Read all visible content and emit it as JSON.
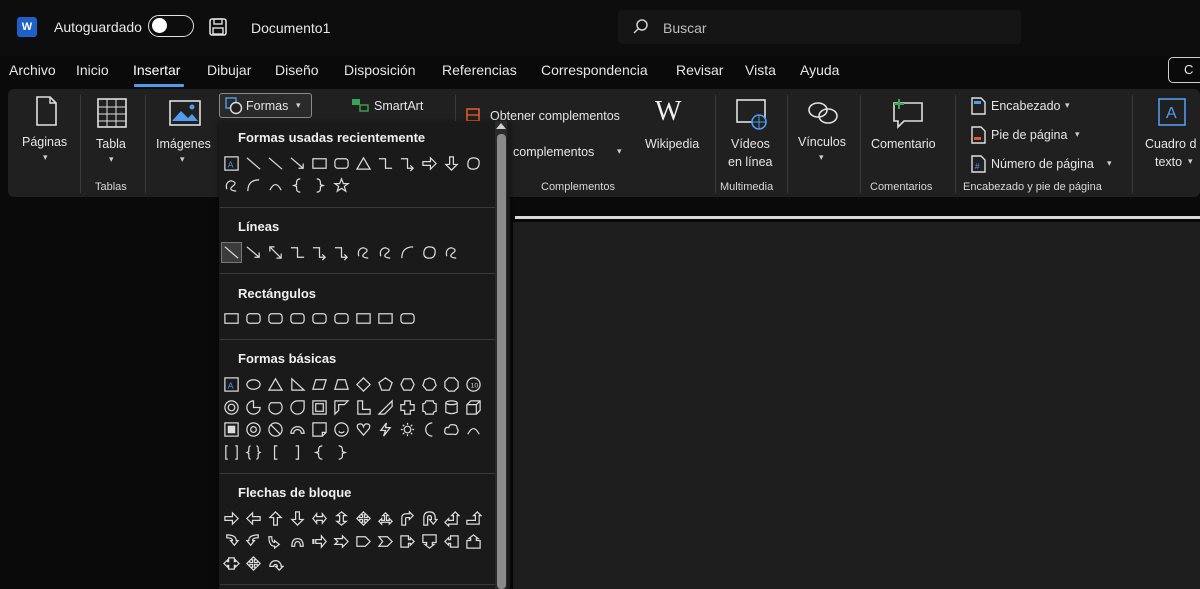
{
  "titlebar": {
    "app_icon": "W",
    "autosave_label": "Autoguardado",
    "document_name": "Documento1",
    "search_placeholder": "Buscar",
    "right_edge_button": "C"
  },
  "tabs": [
    "Archivo",
    "Inicio",
    "Insertar",
    "Dibujar",
    "Diseño",
    "Disposición",
    "Referencias",
    "Correspondencia",
    "Revisar",
    "Vista",
    "Ayuda"
  ],
  "active_tab": "Insertar",
  "ribbon": {
    "pages": "Páginas",
    "table": "Tabla",
    "tables_group": "Tablas",
    "images": "Imágenes",
    "shapes": "Formas",
    "smartart": "SmartArt",
    "get_addins": "Obtener complementos",
    "my_addins": "complementos",
    "addins_group": "Complementos",
    "wikipedia": "Wikipedia",
    "online_video_1": "Vídeos",
    "online_video_2": "en línea",
    "multimedia_group": "Multimedia",
    "links": "Vínculos",
    "comment": "Comentario",
    "comments_group": "Comentarios",
    "header": "Encabezado",
    "footer": "Pie de página",
    "page_number": "Número de página",
    "header_footer_group": "Encabezado y pie de página",
    "textbox_1": "Cuadro d",
    "textbox_2": "texto"
  },
  "shapes_menu": {
    "recent": "Formas usadas recientemente",
    "lines": "Líneas",
    "rectangles": "Rectángulos",
    "basic": "Formas básicas",
    "block_arrows": "Flechas de bloque"
  },
  "colors": {
    "accent": "#4f9cf0",
    "background": "#0a0a0a",
    "ribbon": "#202020"
  }
}
